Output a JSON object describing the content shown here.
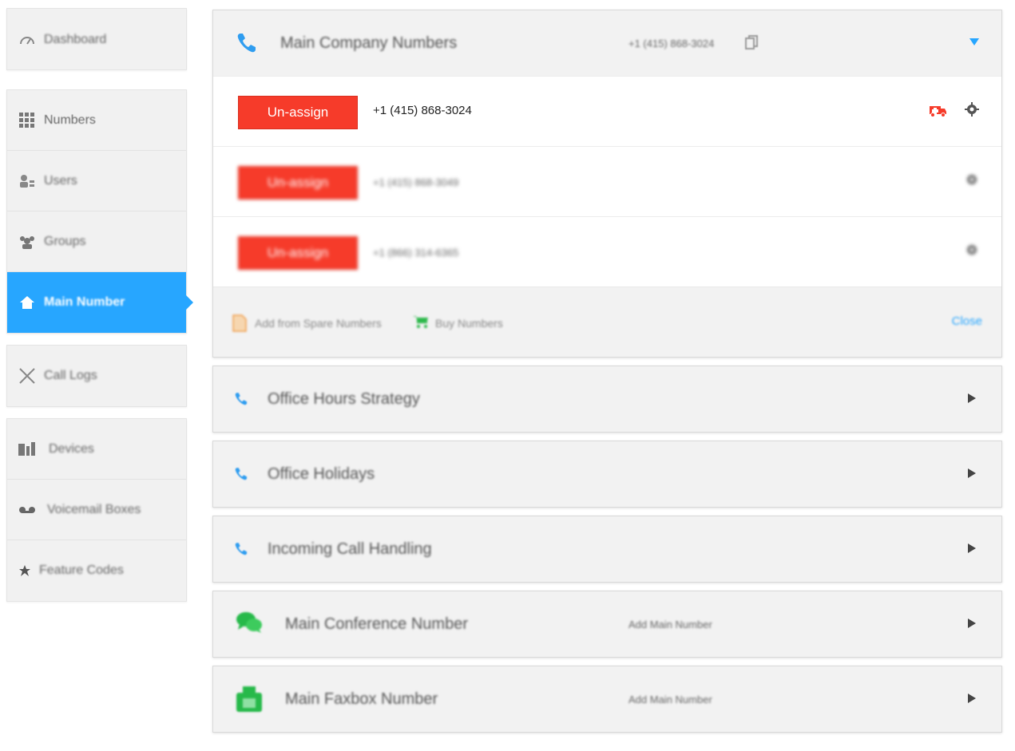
{
  "sidebar": {
    "dashboard": "Dashboard",
    "items": [
      {
        "label": "Numbers",
        "icon": "grid-icon"
      },
      {
        "label": "Users",
        "icon": "users-icon"
      },
      {
        "label": "Groups",
        "icon": "groups-icon"
      },
      {
        "label": "Main Number",
        "icon": "home-icon"
      },
      {
        "label": "Call Logs",
        "icon": "call-logs-icon"
      },
      {
        "label": "Devices",
        "icon": "devices-icon"
      },
      {
        "label": "Voicemail Boxes",
        "icon": "voicemail-icon"
      },
      {
        "label": "Feature Codes",
        "icon": "star-icon"
      }
    ],
    "active_item": "Main Number"
  },
  "main_company": {
    "title": "Main Company Numbers",
    "number": "+1 (415) 868-3024",
    "numbers": [
      {
        "button": "Un-assign",
        "number": "+1 (415) 868-3024"
      },
      {
        "button": "Un-assign",
        "number": "+1 (415) 868-3049"
      },
      {
        "button": "Un-assign",
        "number": "+1 (866) 314-6365"
      }
    ],
    "add_spare": "Add from Spare Numbers",
    "buy": "Buy Numbers",
    "close": "Close"
  },
  "sections": [
    {
      "title": "Office Hours Strategy",
      "sub": ""
    },
    {
      "title": "Office Holidays",
      "sub": ""
    },
    {
      "title": "Incoming Call Handling",
      "sub": ""
    },
    {
      "title": "Main Conference Number",
      "sub": "Add Main Number"
    },
    {
      "title": "Main Faxbox Number",
      "sub": "Add Main Number"
    }
  ],
  "colors": {
    "accent": "#27a6ff",
    "danger": "#f63b2a",
    "success": "#27b94a"
  }
}
